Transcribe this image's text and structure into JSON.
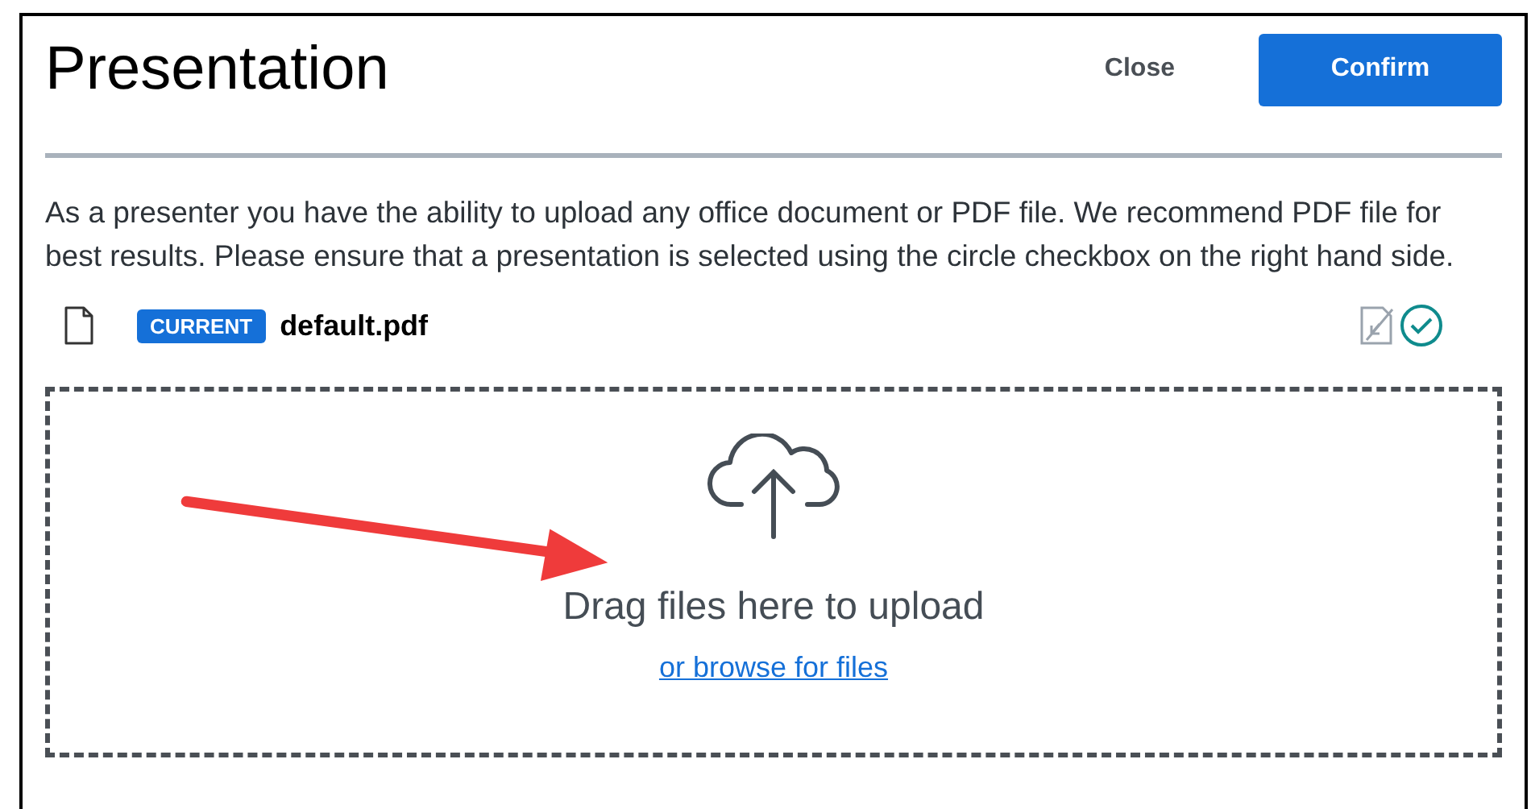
{
  "dialog": {
    "title": "Presentation",
    "close_label": "Close",
    "confirm_label": "Confirm"
  },
  "description": "As a presenter you have the ability to upload any office document or PDF file. We recommend PDF file for best results. Please ensure that a presentation is selected using the circle checkbox on the right hand side.",
  "files": [
    {
      "badge": "CURRENT",
      "name": "default.pdf",
      "selected": true
    }
  ],
  "dropzone": {
    "title": "Drag files here to upload",
    "link": "or browse for files"
  }
}
